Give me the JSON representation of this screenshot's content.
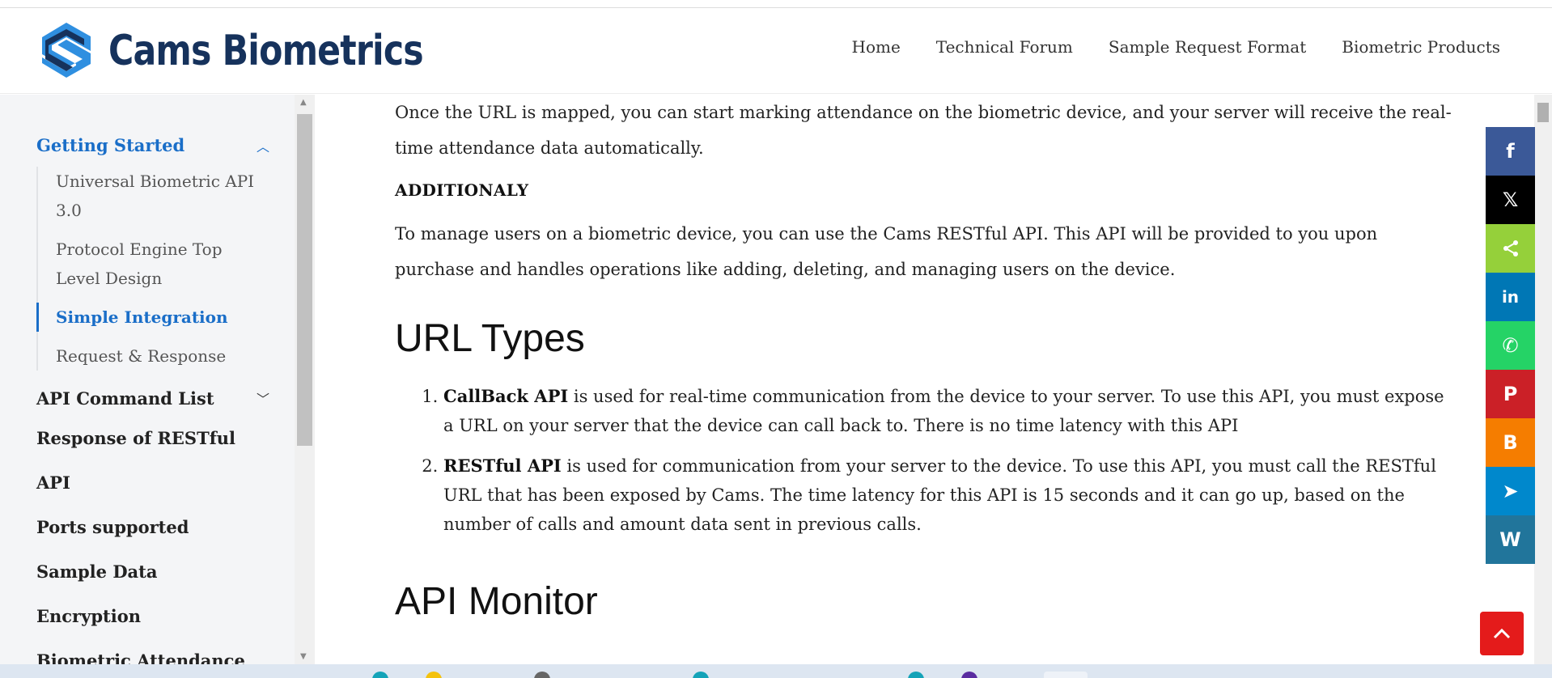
{
  "site": {
    "brand": "Cams Biometrics",
    "colors": {
      "accent": "#1a6ec8",
      "brand_dark": "#16325c",
      "brand_light": "#2f8fe0"
    }
  },
  "nav": [
    {
      "label": "Home"
    },
    {
      "label": "Technical Forum"
    },
    {
      "label": "Sample Request Format"
    },
    {
      "label": "Biometric Products"
    }
  ],
  "sidebar": {
    "groups": [
      {
        "label": "Getting Started",
        "expanded": true,
        "icon": "chevron-up-icon",
        "children": [
          {
            "label": "Universal Biometric API 3.0"
          },
          {
            "label": "Protocol Engine Top Level Design"
          },
          {
            "label": "Simple Integration",
            "active": true
          },
          {
            "label": "Request & Response"
          }
        ]
      },
      {
        "label": "API Command List",
        "expanded": false,
        "icon": "chevron-down-icon"
      }
    ],
    "items": [
      {
        "label": "Response of RESTful API"
      },
      {
        "label": "Ports supported"
      },
      {
        "label": "Sample Data"
      },
      {
        "label": "Encryption"
      },
      {
        "label": "Biometric Attendance"
      }
    ]
  },
  "content": {
    "para1": "Once the URL is mapped, you can start marking attendance on the biometric device, and your server will receive the real-time attendance data automatically.",
    "additional_heading": "ADDITIONALY",
    "para2": "To manage users on a biometric device, you can use the Cams RESTful API. This API will be provided to you upon purchase and handles operations like adding, deleting, and managing users on the device.",
    "url_types_heading": "URL Types",
    "url_types": [
      {
        "term": "CallBack API",
        "text": " is used for real-time communication from the device to your server. To use this API, you must expose a URL on your server that the device can call back to. There is no time latency with this API"
      },
      {
        "term": "RESTful API",
        "text": " is used for communication from your server to the device. To use this API, you must call the RESTful URL that has been exposed by Cams. The time latency for this API is 15 seconds and it can go up, based on the number of calls and amount data sent in previous calls."
      }
    ],
    "api_monitor_heading": "API Monitor"
  },
  "share_buttons": [
    {
      "name": "facebook",
      "glyph": "f",
      "color": "#3b5998"
    },
    {
      "name": "x",
      "glyph": "𝕏",
      "color": "#000000"
    },
    {
      "name": "share",
      "glyph": "<",
      "color": "#95d03a"
    },
    {
      "name": "linkedin",
      "glyph": "in",
      "color": "#0077b5"
    },
    {
      "name": "whatsapp",
      "glyph": "✆",
      "color": "#25d366"
    },
    {
      "name": "pinterest",
      "glyph": "P",
      "color": "#cb2027"
    },
    {
      "name": "blogger",
      "glyph": "B",
      "color": "#f57d00"
    },
    {
      "name": "telegram",
      "glyph": "➤",
      "color": "#0088cc"
    },
    {
      "name": "wordpress",
      "glyph": "W",
      "color": "#21759b"
    }
  ],
  "back_to_top": {
    "icon": "chevron-up-icon",
    "color": "#e41b1b"
  }
}
